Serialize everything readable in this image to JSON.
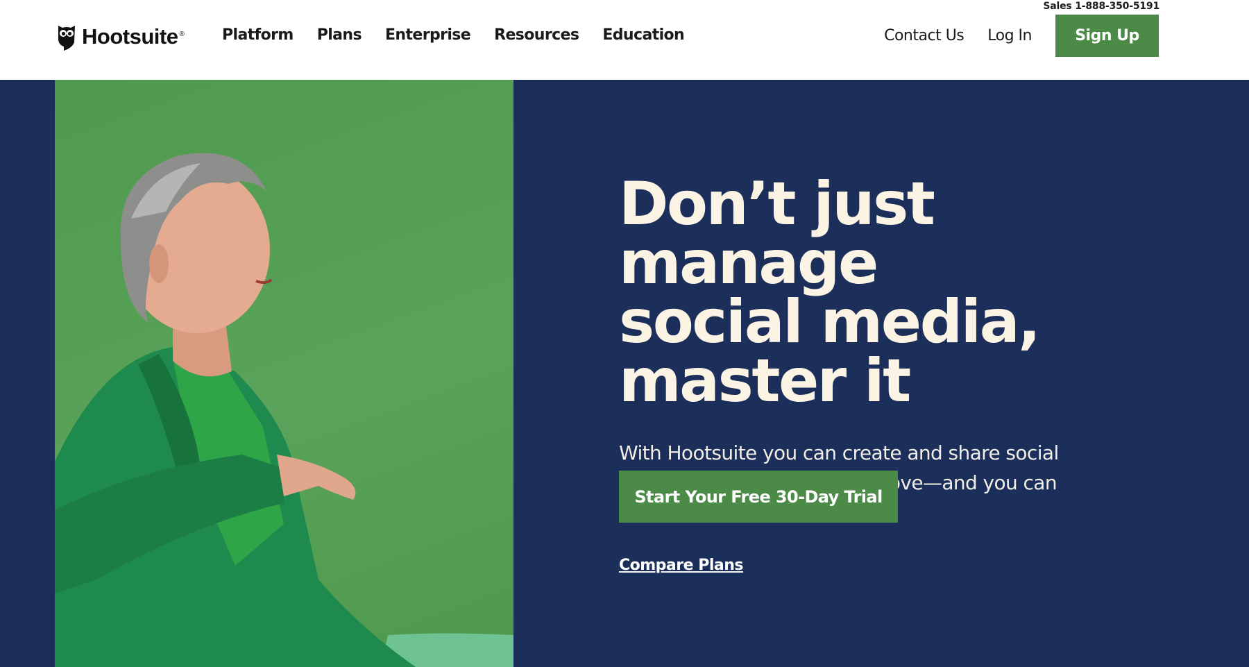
{
  "header": {
    "sales_text": "Sales 1-888-350-5191",
    "logo_text": "Hootsuite",
    "logo_reg": "®",
    "nav": [
      {
        "label": "Platform"
      },
      {
        "label": "Plans"
      },
      {
        "label": "Enterprise"
      },
      {
        "label": "Resources"
      },
      {
        "label": "Education"
      }
    ],
    "contact_label": "Contact Us",
    "login_label": "Log In",
    "signup_label": "Sign Up"
  },
  "hero": {
    "headline_line1": "Don’t just manage",
    "headline_line2": "social media,",
    "headline_line3": "master it",
    "subhead": "With Hootsuite you can create and share social content your customers will love—and you can measure.",
    "cta_label": "Start Your Free 30-Day Trial",
    "compare_label": "Compare Plans"
  },
  "colors": {
    "brand_green": "#4b8b47",
    "hero_navy": "#1c2e5a",
    "headline_cream": "#fbf3e4",
    "photo_green": "#56a055"
  },
  "icons": {
    "logo": "hootsuite-owl-icon"
  }
}
